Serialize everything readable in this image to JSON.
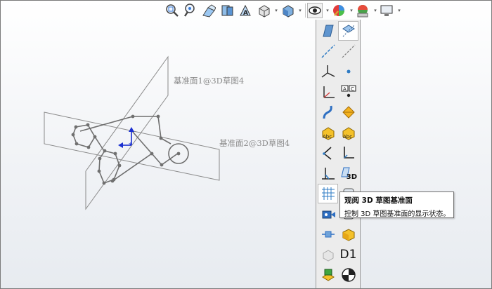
{
  "heads_up_toolbar": {
    "buttons": [
      {
        "icon": "zoom-to-fit-icon"
      },
      {
        "icon": "zoom-to-area-icon"
      },
      {
        "icon": "previous-view-icon"
      },
      {
        "icon": "section-view-icon"
      },
      {
        "icon": "dynamic-annotation-views-icon"
      },
      {
        "icon": "view-orientation-icon"
      },
      {
        "icon": "display-style-icon"
      },
      {
        "icon": "hide-show-items-icon"
      },
      {
        "icon": "edit-appearance-icon"
      },
      {
        "icon": "apply-scene-icon"
      },
      {
        "icon": "view-settings-icon"
      }
    ]
  },
  "graphics_area": {
    "plane1_label": "基准面1@3D草图4",
    "plane2_label": "基准面2@3D草图4"
  },
  "flyout_toolbar": {
    "buttons": [
      {
        "icon": "view-planes-icon"
      },
      {
        "icon": "view-axes-icon",
        "pressed": true
      },
      {
        "icon": "view-temporary-axes-icon"
      },
      {
        "icon": "view-points-icon"
      },
      {
        "icon": "view-coordinate-systems-icon"
      },
      {
        "icon": "view-origins-icon"
      },
      {
        "icon": "view-dimension-names-icon"
      },
      {
        "icon": "view-sketch-relations-icon"
      },
      {
        "icon": "view-curves-icon"
      },
      {
        "icon": "view-parting-lines-icon"
      },
      {
        "icon": "view-annotations-icon"
      },
      {
        "icon": "view-all-annotations-icon"
      },
      {
        "icon": "view-sketch-icon"
      },
      {
        "icon": "view-routing-points-icon"
      },
      {
        "icon": "view-weld-beads-icon"
      },
      {
        "icon": "view-3d-sketch-planes-icon",
        "label": "3D"
      },
      {
        "icon": "view-grid-icon",
        "pressed": true
      },
      {
        "icon": "view-lights-icon"
      },
      {
        "icon": "view-cameras-icon"
      },
      {
        "icon": "view-decals-icon"
      },
      {
        "icon": "view-live-section-planes-icon"
      },
      {
        "icon": "view-bodies-icon"
      },
      {
        "icon": "view-primary-dimensions-icon"
      },
      {
        "icon": "view-dimension-d1-icon",
        "label": "D1"
      },
      {
        "icon": "view-mates-icon"
      },
      {
        "icon": "view-center-of-mass-icon"
      }
    ]
  },
  "tooltip": {
    "title": "观阅 3D 草图基准面",
    "description": "控制 3D 草图基准面的显示状态。"
  }
}
